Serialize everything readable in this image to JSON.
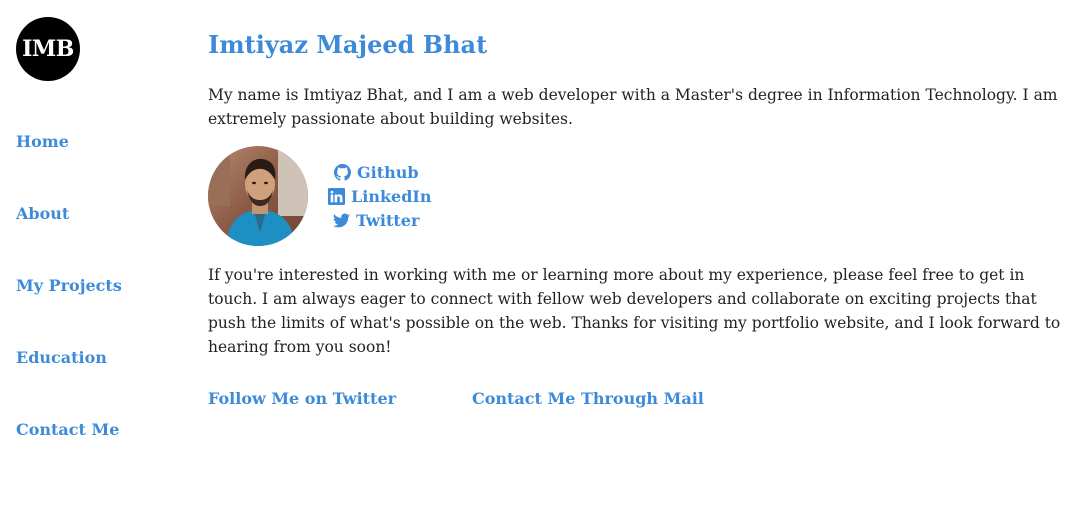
{
  "logo": {
    "text": "IMB"
  },
  "nav": [
    {
      "label": "Home"
    },
    {
      "label": "About"
    },
    {
      "label": "My Projects"
    },
    {
      "label": "Education"
    },
    {
      "label": "Contact Me"
    }
  ],
  "main": {
    "title": "Imtiyaz Majeed Bhat",
    "intro": "My name is Imtiyaz Bhat, and I am a web developer with a Master's degree in Information Technology. I am extremely passionate about building websites.",
    "social": [
      {
        "label": "Github",
        "icon": "github-icon"
      },
      {
        "label": "LinkedIn",
        "icon": "linkedin-icon"
      },
      {
        "label": "Twitter",
        "icon": "twitter-icon"
      }
    ],
    "body": "If you're interested in working with me or learning more about my experience, please feel free to get in touch. I am always eager to connect with fellow web developers and collaborate on exciting projects that push the limits of what's possible on the web. Thanks for visiting my portfolio website, and I look forward to hearing from you soon!",
    "cta_twitter": "Follow Me on Twitter",
    "cta_mail": "Contact Me Through Mail"
  },
  "colors": {
    "accent": "#3d8bd8",
    "text": "#222222",
    "logo_bg": "#000000"
  }
}
